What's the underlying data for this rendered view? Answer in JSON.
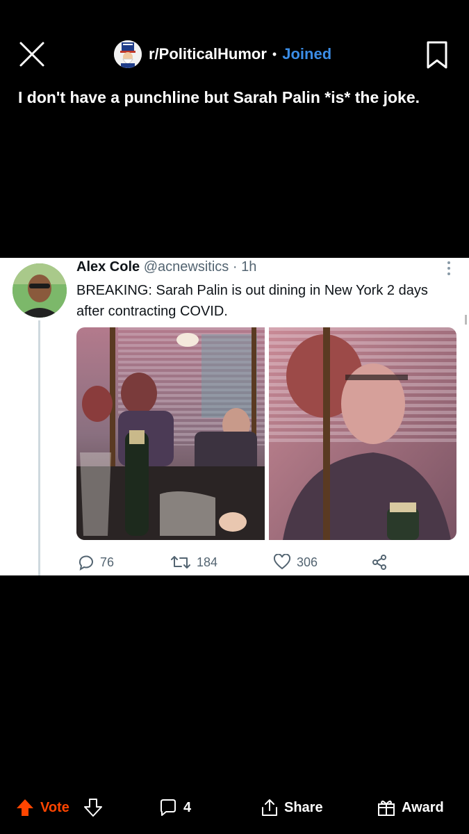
{
  "header": {
    "subreddit": "r/PoliticalHumor",
    "separator": "•",
    "joined_label": "Joined"
  },
  "post": {
    "title": "I don't have a punchline but Sarah Palin *is* the joke."
  },
  "tweet": {
    "author_name": "Alex Cole",
    "handle": "@acnewsitics",
    "separator": "·",
    "time": "1h",
    "text": "BREAKING: Sarah Palin is out dining in New York 2 days after contracting COVID.",
    "replies": "76",
    "retweets": "184",
    "likes": "306"
  },
  "actions": {
    "vote_label": "Vote",
    "comments_count": "4",
    "share_label": "Share",
    "award_label": "Award"
  },
  "colors": {
    "background": "#000000",
    "joined": "#3b8de6",
    "upvote": "#ff4500",
    "tweet_secondary": "#536471"
  },
  "icons": [
    "close-icon",
    "subreddit-avatar-icon",
    "bookmark-icon",
    "more-icon",
    "reply-icon",
    "retweet-icon",
    "like-icon",
    "share-network-icon",
    "upvote-arrow-icon",
    "downvote-arrow-icon",
    "comment-icon",
    "share-icon",
    "award-icon"
  ]
}
